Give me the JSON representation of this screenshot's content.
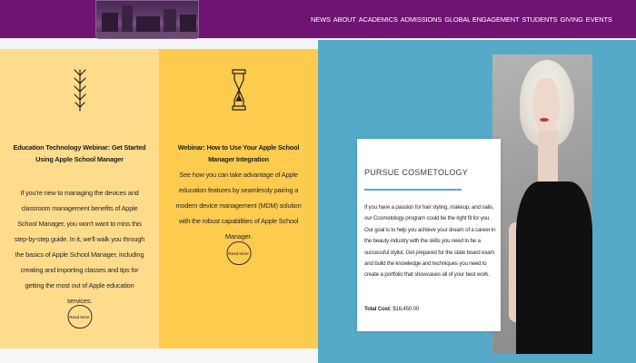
{
  "header": {
    "nav": [
      "NEWS",
      "ABOUT",
      "ACADEMICS",
      "ADMISSIONS",
      "GLOBAL ENGAGEMENT",
      "STUDENTS",
      "GIVING",
      "EVENTS"
    ]
  },
  "cards": [
    {
      "icon": "feather-arrow-icon",
      "title": "Education Technology Webinar: Get Started Using Apple School Manager",
      "description": "If you're new to managing the devices and classroom management benefits of Apple School Manager, you won't want to miss this step-by-step guide. In it, we'll walk you through the basics of Apple School Manager, including creating and importing classes and tips for getting the most out of Apple education services.",
      "button": "Read More"
    },
    {
      "icon": "hourglass-icon",
      "title": "Webinar: How to Use Your Apple School Manager Integration",
      "description": "See how you can take advantage of Apple education features by seamlessly pairing a modern device management (MDM) solution with the robust capabilities of Apple School Manager.",
      "button": "Read More"
    }
  ],
  "feature": {
    "heading": "PURSUE COSMETOLOGY",
    "body": "If you have a passion for hair styling, makeup, and nails, our Cosmetology program could be the right fit for you. Our goal is to help you achieve your dream of a career in the beauty industry with the skills you need to be a successful stylist. Get prepared for the state board exam and build the knowledge and techniques you need to create a portfolio that showcases all of your best work.",
    "cost_label": "Total Cost:",
    "cost_value": "$16,450.00"
  },
  "colors": {
    "header_bg": "#6f1473",
    "card1_bg": "#fedc8c",
    "card2_bg": "#fdcb4e",
    "panel_bg": "#55aac9"
  }
}
